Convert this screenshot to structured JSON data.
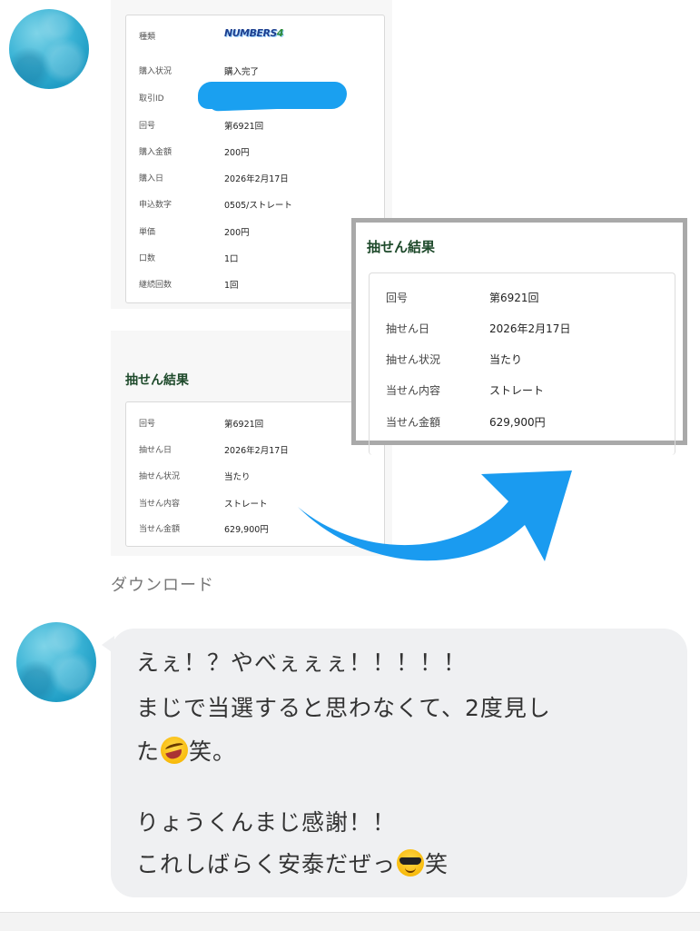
{
  "purchase": {
    "rows": [
      {
        "key": "種類",
        "value": ""
      },
      {
        "key": "購入状況",
        "value": "購入完了"
      },
      {
        "key": "取引ID",
        "value": ""
      },
      {
        "key": "回号",
        "value": "第6921回"
      },
      {
        "key": "購入金額",
        "value": "200円"
      },
      {
        "key": "購入日",
        "value": "2026年2月17日"
      },
      {
        "key": "申込数字",
        "value": "0505/ストレート"
      },
      {
        "key": "単価",
        "value": "200円"
      },
      {
        "key": "口数",
        "value": "1口"
      },
      {
        "key": "継続回数",
        "value": "1回"
      }
    ],
    "logo": {
      "text": "NUMBERS",
      "digit": "4"
    }
  },
  "result": {
    "title": "抽せん結果",
    "rows": [
      {
        "key": "回号",
        "value": "第6921回"
      },
      {
        "key": "抽せん日",
        "value": "2026年2月17日"
      },
      {
        "key": "抽せん状況",
        "value": "当たり"
      },
      {
        "key": "当せん内容",
        "value": "ストレート"
      },
      {
        "key": "当せん金額",
        "value": "629,900円"
      }
    ]
  },
  "download_label": "ダウンロード",
  "message": {
    "lines": [
      "えぇ！？やべぇぇぇ！！！！！",
      "まじで当選すると思わなくて、2度見し",
      "た",
      "笑。",
      "りょうくんまじ感謝！！",
      "これしばらく安泰だぜっ",
      "笑"
    ],
    "emojis": [
      "rolling-on-floor-laughing",
      "smiling-face-with-sunglasses"
    ]
  },
  "colors": {
    "arrow": "#1a9bf0",
    "redaction": "#1aa0f0",
    "bubble": "#eff0f2",
    "avatar": "#3bb4d6",
    "result_title": "#1e4a2b"
  }
}
